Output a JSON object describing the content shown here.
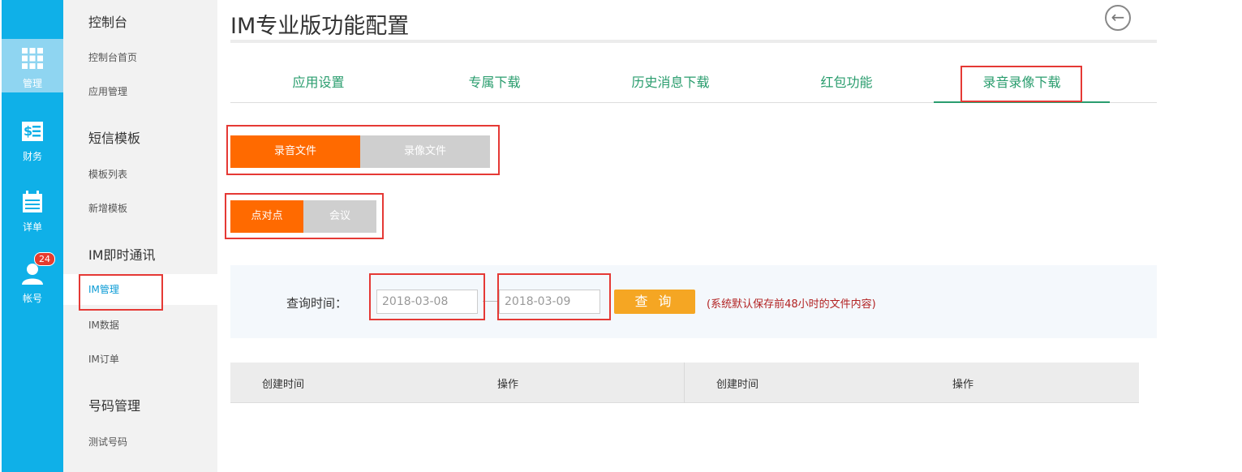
{
  "rail": {
    "items": [
      {
        "label": "管理",
        "icon": "grid-icon"
      },
      {
        "label": "财务",
        "icon": "money-icon"
      },
      {
        "label": "详单",
        "icon": "calendar-icon"
      },
      {
        "label": "帐号",
        "icon": "user-icon",
        "badge": "24"
      }
    ]
  },
  "submenu": {
    "items": [
      {
        "label": "控制台",
        "type": "header"
      },
      {
        "label": "控制台首页"
      },
      {
        "label": "应用管理"
      },
      {
        "label": "短信模板",
        "type": "header"
      },
      {
        "label": "模板列表"
      },
      {
        "label": "新增模板"
      },
      {
        "label": "IM即时通讯",
        "type": "header"
      },
      {
        "label": "IM管理",
        "selected": true
      },
      {
        "label": "IM数据"
      },
      {
        "label": "IM订单"
      },
      {
        "label": "号码管理",
        "type": "header"
      },
      {
        "label": "测试号码"
      }
    ]
  },
  "page": {
    "title": "IM专业版功能配置",
    "back_icon": "back-arrow-icon"
  },
  "tabs": [
    {
      "label": "应用设置"
    },
    {
      "label": "专属下载"
    },
    {
      "label": "历史消息下载"
    },
    {
      "label": "红包功能"
    },
    {
      "label": "录音录像下载",
      "active": true
    }
  ],
  "file_type": {
    "options": [
      "录音文件",
      "录像文件"
    ],
    "selected": "录音文件"
  },
  "call_type": {
    "options": [
      "点对点",
      "会议"
    ],
    "selected": "点对点"
  },
  "query": {
    "label": "查询时间：",
    "start_date": "2018-03-08",
    "end_date": "2018-03-09",
    "button": "查 询",
    "note": "(系统默认保存前48小时的文件内容)"
  },
  "table": {
    "headers": [
      "创建时间",
      "操作",
      "创建时间",
      "操作"
    ]
  },
  "colors": {
    "rail": "#0fb0e8",
    "accent": "#ff6a00",
    "tab_green": "#2a9d6e",
    "button_orange": "#f5a623",
    "highlight_red": "#e53935"
  }
}
